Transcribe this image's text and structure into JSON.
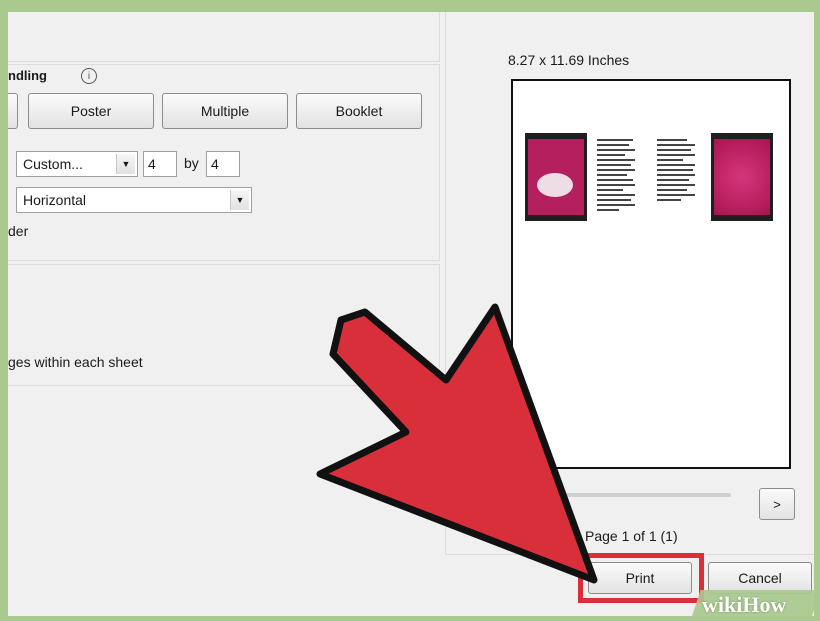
{
  "page_handling": {
    "title": "ndling",
    "info_icon": "info-icon",
    "buttons": [
      {
        "label": "Poster"
      },
      {
        "label": "Multiple"
      },
      {
        "label": "Booklet"
      }
    ],
    "pages_per_sheet": {
      "value": "Custom...",
      "cols": "4",
      "by_label": "by",
      "rows": "4"
    },
    "page_order": "Horizontal",
    "border_label": "der",
    "auto_rotate_label": "ges within each sheet"
  },
  "preview": {
    "page_size": "8.27 x 11.69 Inches",
    "next_label": ">",
    "page_status": "Page 1 of 1 (1)"
  },
  "footer": {
    "print_label": "Print",
    "cancel_label": "Cancel"
  },
  "watermark": "wikiHow",
  "colors": {
    "arrow": "#d92f3a",
    "highlight": "#d92f3a",
    "page_bg": "#f0f0f0",
    "frame": "#a9c98f"
  }
}
